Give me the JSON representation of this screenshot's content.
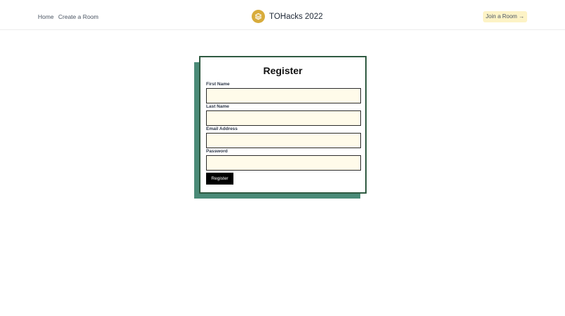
{
  "header": {
    "nav": [
      {
        "label": "Home"
      },
      {
        "label": "Create a Room"
      }
    ],
    "brand": {
      "name": "TOHacks 2022",
      "icon": "layers-icon",
      "color": "#d8ac3c"
    },
    "join_button": {
      "label": "Join a Room",
      "arrow": "→"
    }
  },
  "form": {
    "title": "Register",
    "fields": [
      {
        "label": "First Name",
        "value": "",
        "placeholder": ""
      },
      {
        "label": "Last Name",
        "value": "",
        "placeholder": ""
      },
      {
        "label": "Email Address",
        "value": "",
        "placeholder": ""
      },
      {
        "label": "Password",
        "value": "",
        "placeholder": ""
      }
    ],
    "submit_label": "Register"
  },
  "colors": {
    "card_border": "#2f5a41",
    "card_shadow": "#4a8a77",
    "input_background": "#fffbea",
    "join_button_background": "#fdf3c6"
  }
}
